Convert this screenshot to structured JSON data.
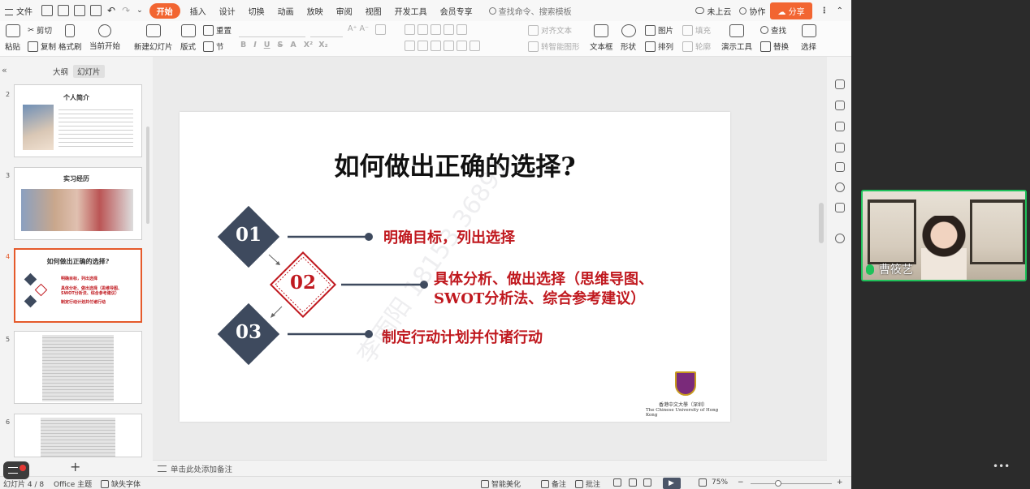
{
  "menubar": {
    "file_label": "文件",
    "tabs": [
      "开始",
      "插入",
      "设计",
      "切换",
      "动画",
      "放映",
      "审阅",
      "视图",
      "开发工具",
      "会员专享"
    ],
    "search_placeholder": "查找命令、搜索模板",
    "cloud_label": "未上云",
    "collab_label": "协作",
    "share_label": "分享"
  },
  "toolbar": {
    "paste": "粘贴",
    "cut": "剪切",
    "copy": "复制",
    "format_painter": "格式刷",
    "play_from_current": "当前开始",
    "new_slide": "新建幻灯片",
    "layout": "版式",
    "section": "节",
    "reset": "重置",
    "align_text": "对齐文本",
    "convert_smartart": "转智能图形",
    "textbox": "文本框",
    "shape": "形状",
    "picture": "图片",
    "arrange": "排列",
    "fill": "填充",
    "outline": "轮廓",
    "presentation_tools": "演示工具",
    "find": "查找",
    "replace": "替换",
    "select": "选择",
    "bold": "B",
    "italic": "I",
    "underline": "U",
    "strike": "S",
    "font_color": "A",
    "superscript": "X²",
    "subscript": "X₂"
  },
  "left_panel": {
    "tab_outline": "大纲",
    "tab_slides": "幻灯片",
    "add_slide": "+",
    "thumbnails": [
      {
        "num": "2",
        "title": "个人简介"
      },
      {
        "num": "3",
        "title": "实习经历"
      },
      {
        "num": "4",
        "title": "如何做出正确的选择?"
      },
      {
        "num": "5",
        "title": ""
      },
      {
        "num": "6",
        "title": ""
      }
    ],
    "thumb4": {
      "item1": "明确目标，列出选择",
      "item2": "具体分析、做出选择（思维导图、",
      "item2b": "SWOT分析法、综合参考建议）",
      "item3": "制定行动计划并付诸行动"
    }
  },
  "slide": {
    "title": "如何做出正确的选择?",
    "steps": [
      {
        "num": "01",
        "text": "明确目标，列出选择"
      },
      {
        "num": "02",
        "text": "具体分析、做出选择（思维导图、",
        "text2": "SWOT分析法、综合参考建议）"
      },
      {
        "num": "03",
        "text": "制定行动计划并付诸行动"
      }
    ],
    "university_cn": "香港中文大學（深圳）",
    "university_en": "The Chinese University of Hong Kong",
    "watermark": "李雨阳 18153 36891"
  },
  "notes": {
    "placeholder": "单击此处添加备注"
  },
  "statusbar": {
    "slide_counter": "幻灯片 4 / 8",
    "theme": "Office 主题",
    "missing_font": "缺失字体",
    "smart_beautify": "智能美化",
    "notes": "备注",
    "comments": "批注",
    "zoom": "75%"
  },
  "video": {
    "participant_name": "曹筱艺"
  },
  "colors": {
    "accent": "#f26531",
    "diamond_navy": "#3e4a5e",
    "slide_red": "#c0191f",
    "speaking_green": "#1fc15a"
  }
}
